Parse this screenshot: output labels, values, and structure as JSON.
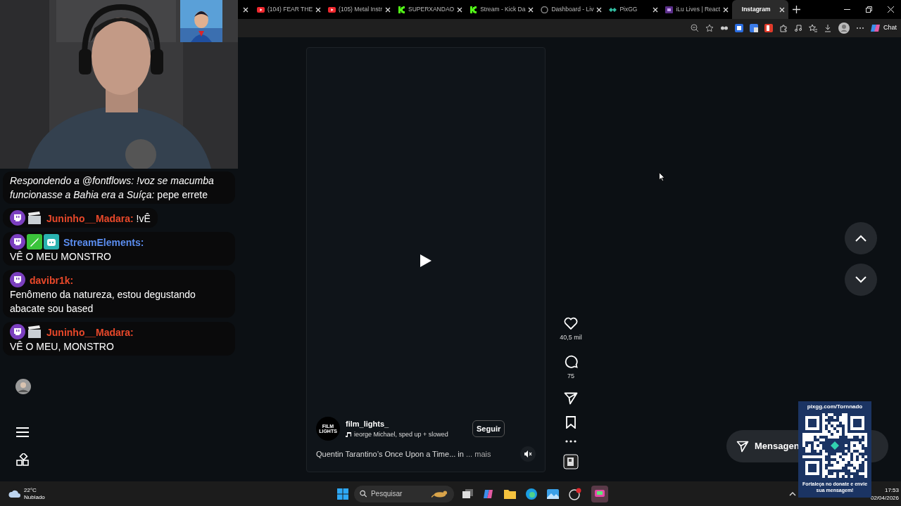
{
  "browser": {
    "tabs": [
      {
        "label": "(104) FEAR THE",
        "kind": "youtube",
        "selected": false
      },
      {
        "label": "(105) Metal Instr",
        "kind": "youtube",
        "selected": false
      },
      {
        "label": "SUPERXANDAO",
        "kind": "kick",
        "selected": false
      },
      {
        "label": "Stream - Kick Da",
        "kind": "kick",
        "selected": false
      },
      {
        "label": "Dashboard - Liv",
        "kind": "circle",
        "selected": false
      },
      {
        "label": "PixGG",
        "kind": "pix",
        "selected": false
      },
      {
        "label": "iLu Lives | React",
        "kind": "ilu",
        "selected": false
      },
      {
        "label": "Instagram",
        "kind": "none",
        "selected": true
      }
    ],
    "chat_button": "Chat"
  },
  "chat": [
    {
      "text": "*Respondendo a @fontflows: !voz se macumba funcionasse a Bahia era a Suíça:* pepe errete"
    },
    {
      "badges": [
        {
          "kind": "twitch"
        },
        {
          "kind": "clapper"
        }
      ],
      "user": "Juninho__Madara:",
      "color": "#e8482a",
      "text": "!vÊ"
    },
    {
      "badges": [
        {
          "kind": "twitch"
        },
        {
          "kind": "sword"
        },
        {
          "kind": "robot"
        }
      ],
      "user": "StreamElements:",
      "color": "#5b8def",
      "text": "VÊ O MEU MONSTRO"
    },
    {
      "badges": [
        {
          "kind": "twitch"
        }
      ],
      "user": "davibr1k:",
      "color": "#e8482a",
      "text": "Fenômeno da natureza, estou degustando abacate sou based"
    },
    {
      "badges": [
        {
          "kind": "twitch"
        },
        {
          "kind": "clapper"
        }
      ],
      "user": "Juninho__Madara:",
      "color": "#e8482a",
      "text": "VÊ O MEU, MONSTRO"
    }
  ],
  "reel": {
    "logo_text": "FILM LIGHTS",
    "username": "film_lights_",
    "audio": "ieorge Michael, sped up + slowed",
    "follow_button": "Seguir",
    "caption": "Quentin Tarantino’s Once Upon a Time... in",
    "more": "... mais",
    "muted": true,
    "actions": [
      {
        "kind": "like",
        "count": "40,5 mil"
      },
      {
        "kind": "comment",
        "count": "75"
      },
      {
        "kind": "share"
      },
      {
        "kind": "save"
      },
      {
        "kind": "more"
      },
      {
        "kind": "audio"
      }
    ]
  },
  "messages_button": "Mensagen",
  "donation": {
    "url": "pixgg.com/Tornnado",
    "text": "Fortaleça no donate e envie sua mensagem!"
  },
  "taskbar": {
    "temperature": "22°C",
    "weather": "Nublado",
    "search_placeholder": "Pesquisar",
    "time": "17:53",
    "date": "02/04/2026"
  }
}
